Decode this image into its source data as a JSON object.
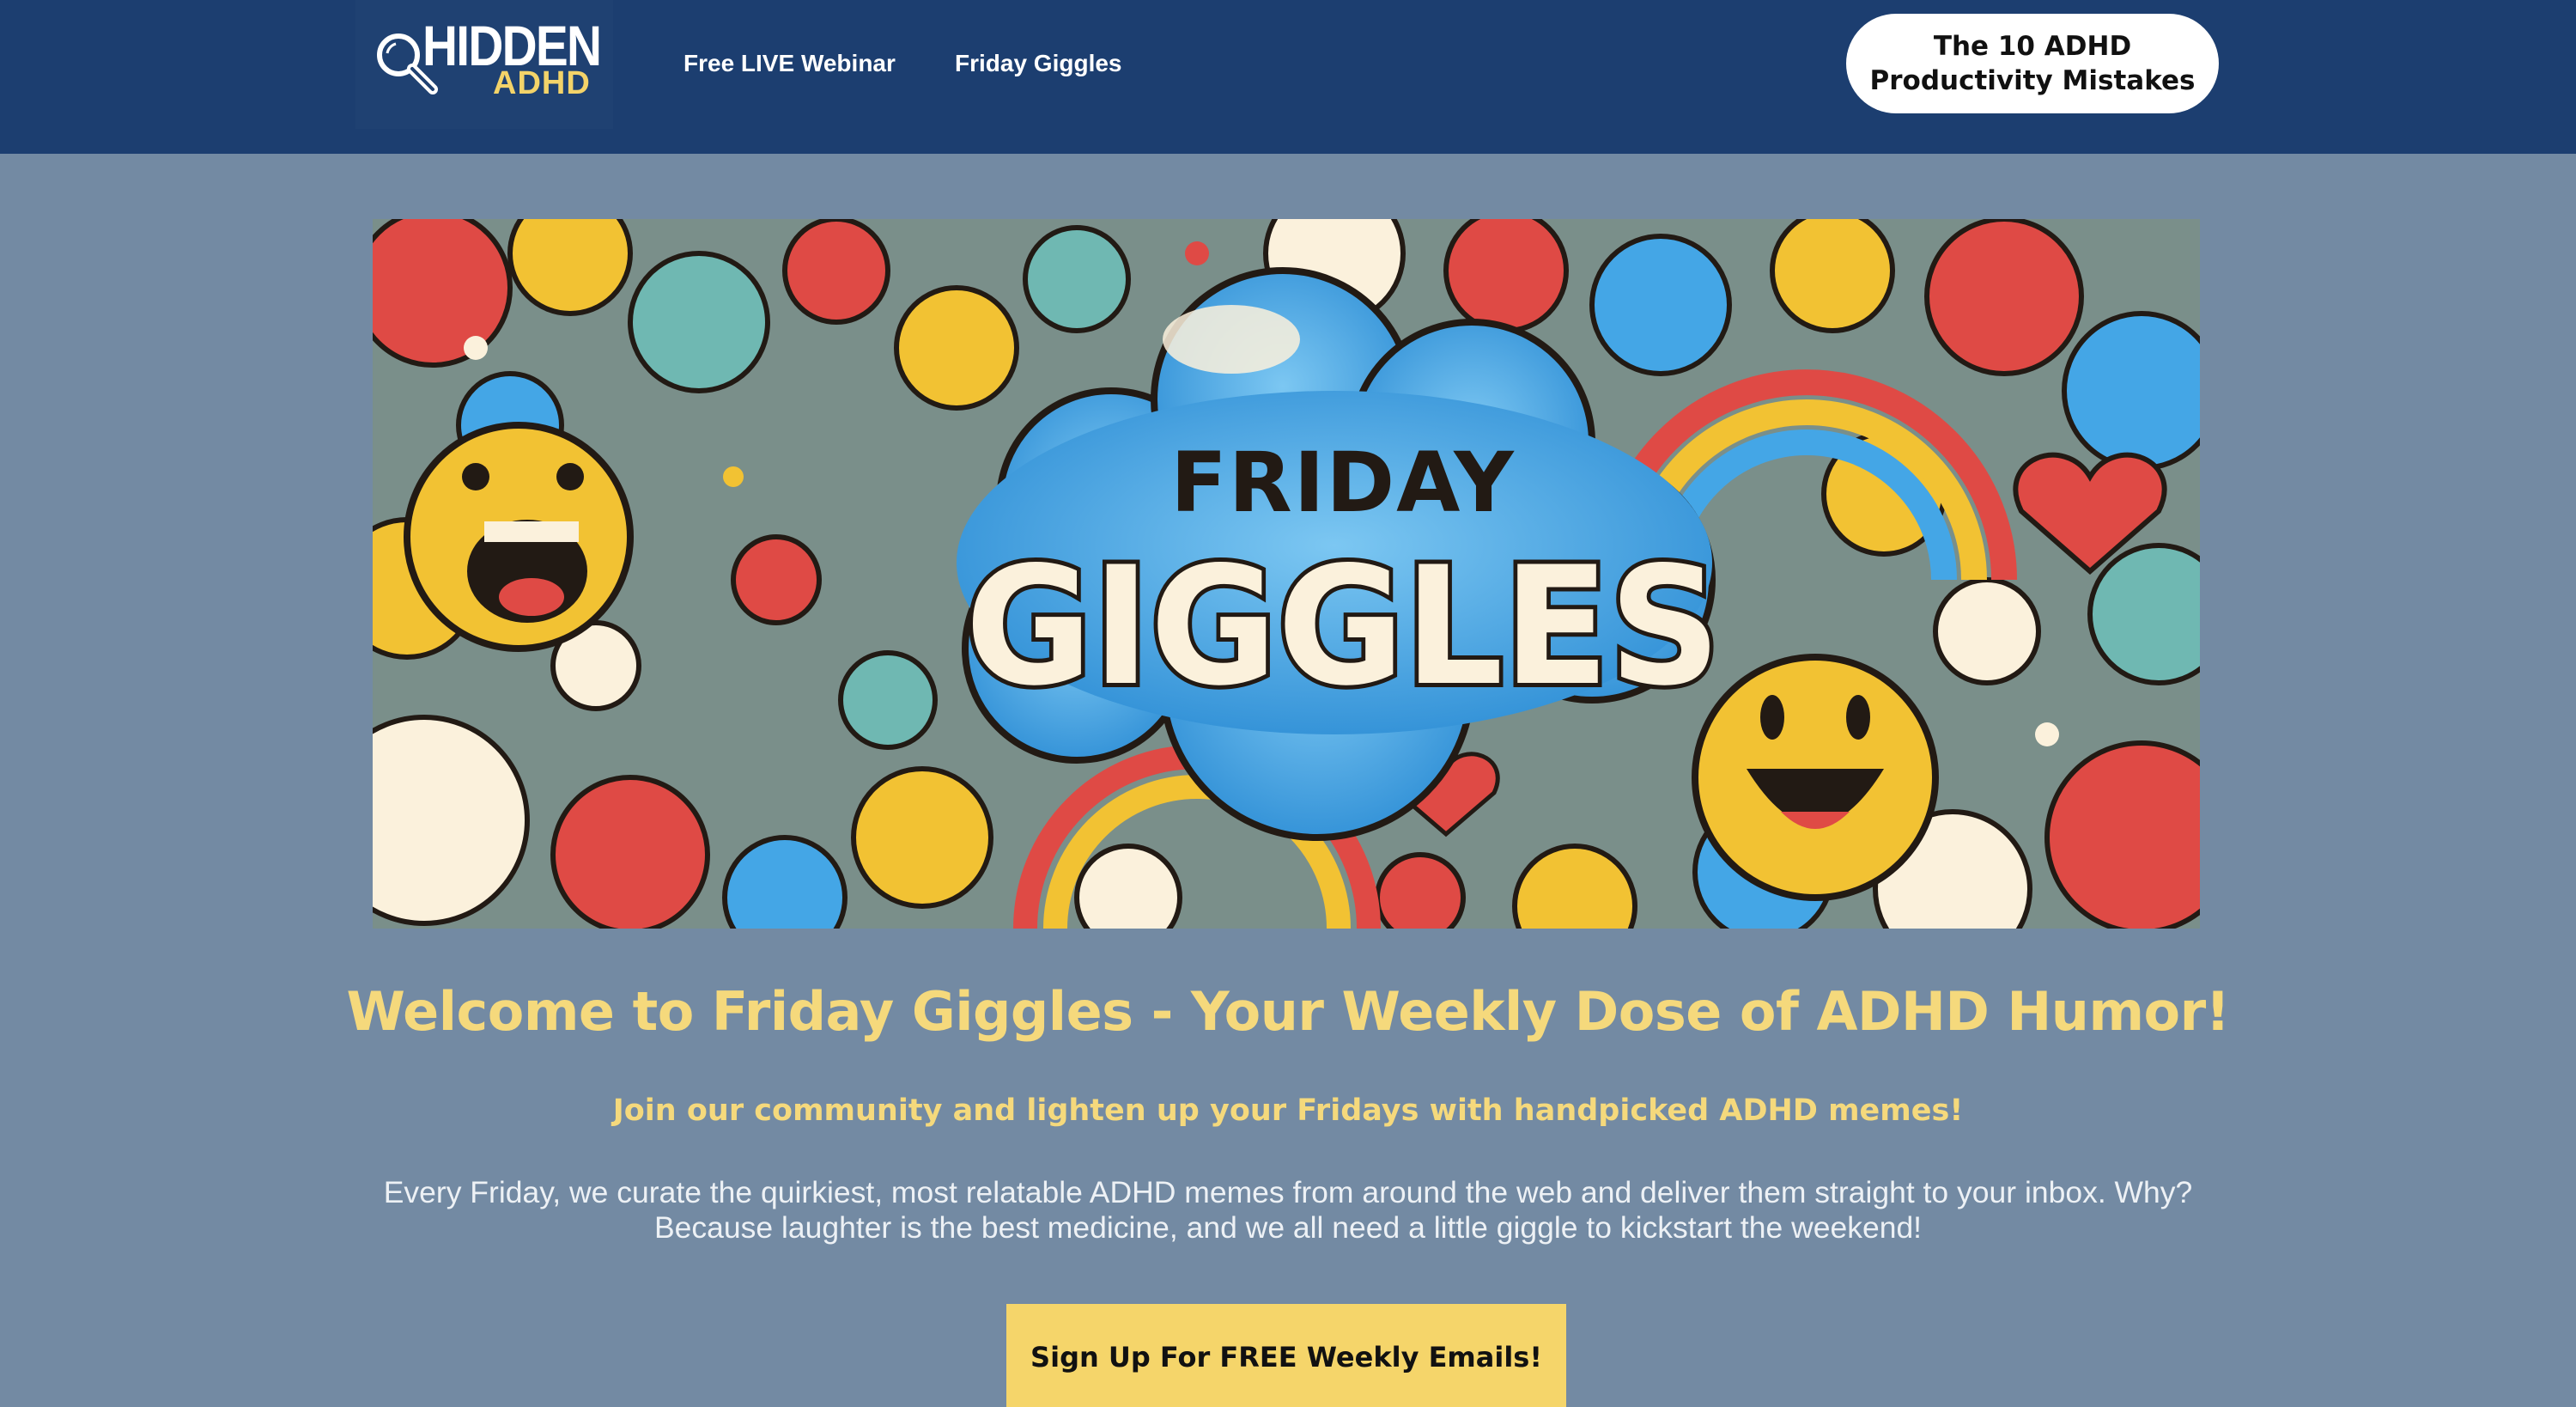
{
  "header": {
    "logo": {
      "word_top": "HIDDEN",
      "word_bottom": "ADHD",
      "icon": "magnifier-icon"
    },
    "nav": [
      {
        "label": "Free LIVE Webinar"
      },
      {
        "label": "Friday Giggles"
      }
    ],
    "cta": {
      "line1": "The 10 ADHD",
      "line2": "Productivity Mistakes"
    }
  },
  "banner": {
    "title_top": "FRIDAY",
    "title_main": "GIGGLES",
    "colors": {
      "cloud": "#44a6e6",
      "text": "#fbf1dc",
      "outline": "#221a14",
      "red": "#df4a45",
      "yellow": "#f2c233",
      "teal": "#6fb8b2"
    }
  },
  "main": {
    "headline": "Welcome to Friday Giggles - Your Weekly Dose of ADHD Humor!",
    "subhead": "Join our community and lighten up your Fridays with handpicked ADHD memes!",
    "body_line1": "Every Friday, we curate the quirkiest, most relatable ADHD memes from around the web and deliver them straight to your inbox. Why?",
    "body_line2": "Because laughter is the best medicine, and we all need a little giggle to kickstart the weekend!",
    "signup_label": "Sign Up For FREE Weekly Emails!"
  },
  "colors": {
    "header_bg": "#1c3e70",
    "page_bg": "#738aa3",
    "accent_yellow": "#f5d97c",
    "button_yellow": "#f5d56a"
  }
}
